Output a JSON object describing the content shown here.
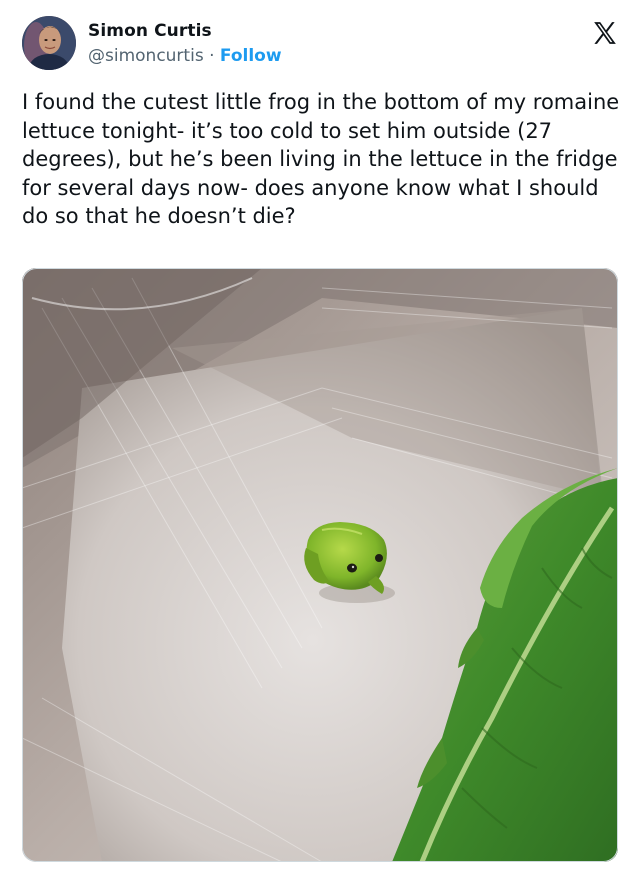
{
  "author": {
    "display_name": "Simon Curtis",
    "handle": "@simoncurtis",
    "separator": "·",
    "follow_label": "Follow"
  },
  "platform": {
    "logo_icon": "x-logo-icon"
  },
  "tweet": {
    "text": "I found the cutest little frog in the bottom of my romaine lettuce tonight- it’s too cold to set him outside (27 degrees), but he’s been living in the lettuce in the fridge for several days now- does anyone know what I should do so that he doesn’t die?"
  },
  "media": {
    "icon": "photo-frog-in-lettuce-container"
  },
  "colors": {
    "link": "#1d9bf0",
    "secondary_text": "#536471",
    "primary_text": "#0f1419"
  }
}
